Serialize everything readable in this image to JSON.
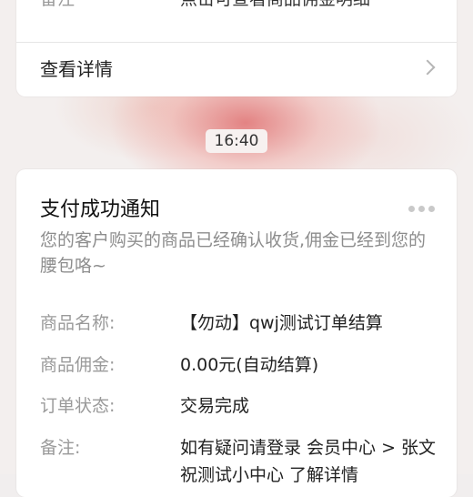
{
  "top_card": {
    "note_label": "备注",
    "note_value": "点击可查看商品佣金明细",
    "view_details": "查看详情"
  },
  "timestamp": "16:40",
  "notification": {
    "title": "支付成功通知",
    "description": "您的客户购买的商品已经确认收货,佣金已经到您的腰包咯~",
    "fields": [
      {
        "label": "商品名称:",
        "value": "【勿动】qwj测试订单结算"
      },
      {
        "label": "商品佣金:",
        "value": "0.00元(自动结算)"
      },
      {
        "label": "订单状态:",
        "value": "交易完成"
      },
      {
        "label": "备注:",
        "value": "如有疑问请登录 会员中心 > 张文祝测试小中心 了解详情"
      }
    ]
  }
}
